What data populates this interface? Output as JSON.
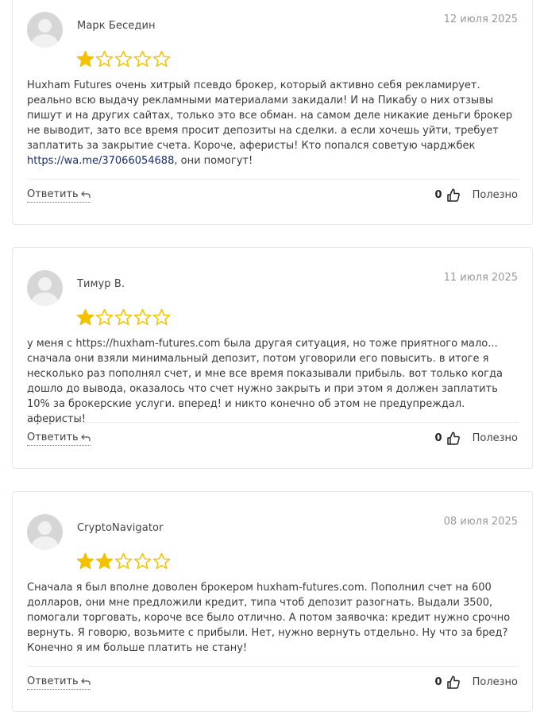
{
  "colors": {
    "star_filled": "#f2c200",
    "star_empty_stroke": "#f2c200",
    "link": "#1a2f6e"
  },
  "icons": {
    "avatar": "user-placeholder-icon",
    "reply": "reply-arrow-icon",
    "like": "thumbs-up-icon",
    "star": "star-icon"
  },
  "reviews": [
    {
      "author": "Марк Беседин",
      "date": "12 июля 2025",
      "rating": 1,
      "text_before_link": "Huxham Futures очень хитрый псевдо брокер, который активно себя рекламирует. реально всю выдачу рекламными материалами закидали! И на Пикабу о них отзывы пишут и на других сайтах, только это все обман. на самом деле никакие деньги брокер не выводит, зато все время просит депозиты на сделки. а если хочешь уйти, требует заплатить за закрытие счета. Короче, аферисты! Кто попался советую чарджбек ",
      "link": "https://wa.me/37066054688",
      "text_after_link": ", они помогут!",
      "reply_label": "Ответить",
      "likes": "0",
      "useful_label": "Полезно"
    },
    {
      "author": "Тимур В.",
      "date": "11 июля 2025",
      "rating": 1,
      "text": "у меня с https://huxham-futures.com была другая ситуация, но тоже приятного мало... сначала они взяли минимальный депозит, потом уговорили его повысить. в итоге я несколько раз пополнял счет, и мне все время показывали прибыль. вот только когда дошло до вывода, оказалось что счет нужно закрыть и при этом я должен заплатить 10% за брокерские услуги. вперед! и никто конечно об этом не предупреждал. аферисты!",
      "reply_label": "Ответить",
      "likes": "0",
      "useful_label": "Полезно"
    },
    {
      "author": "CryptoNavigator",
      "date": "08 июля 2025",
      "rating": 2,
      "text": "Сначала я был вполне доволен брокером huxham-futures.com. Пополнил счет на 600 долларов, они мне предложили кредит, типа чтоб депозит разогнать. Выдали 3500, помогали торговать, короче все было отлично. А потом заявочка: кредит нужно срочно вернуть. Я говорю, возьмите с прибыли. Нет, нужно вернуть отдельно. Ну что за бред? Конечно я им больше платить не стану!",
      "reply_label": "Ответить",
      "likes": "0",
      "useful_label": "Полезно"
    }
  ]
}
